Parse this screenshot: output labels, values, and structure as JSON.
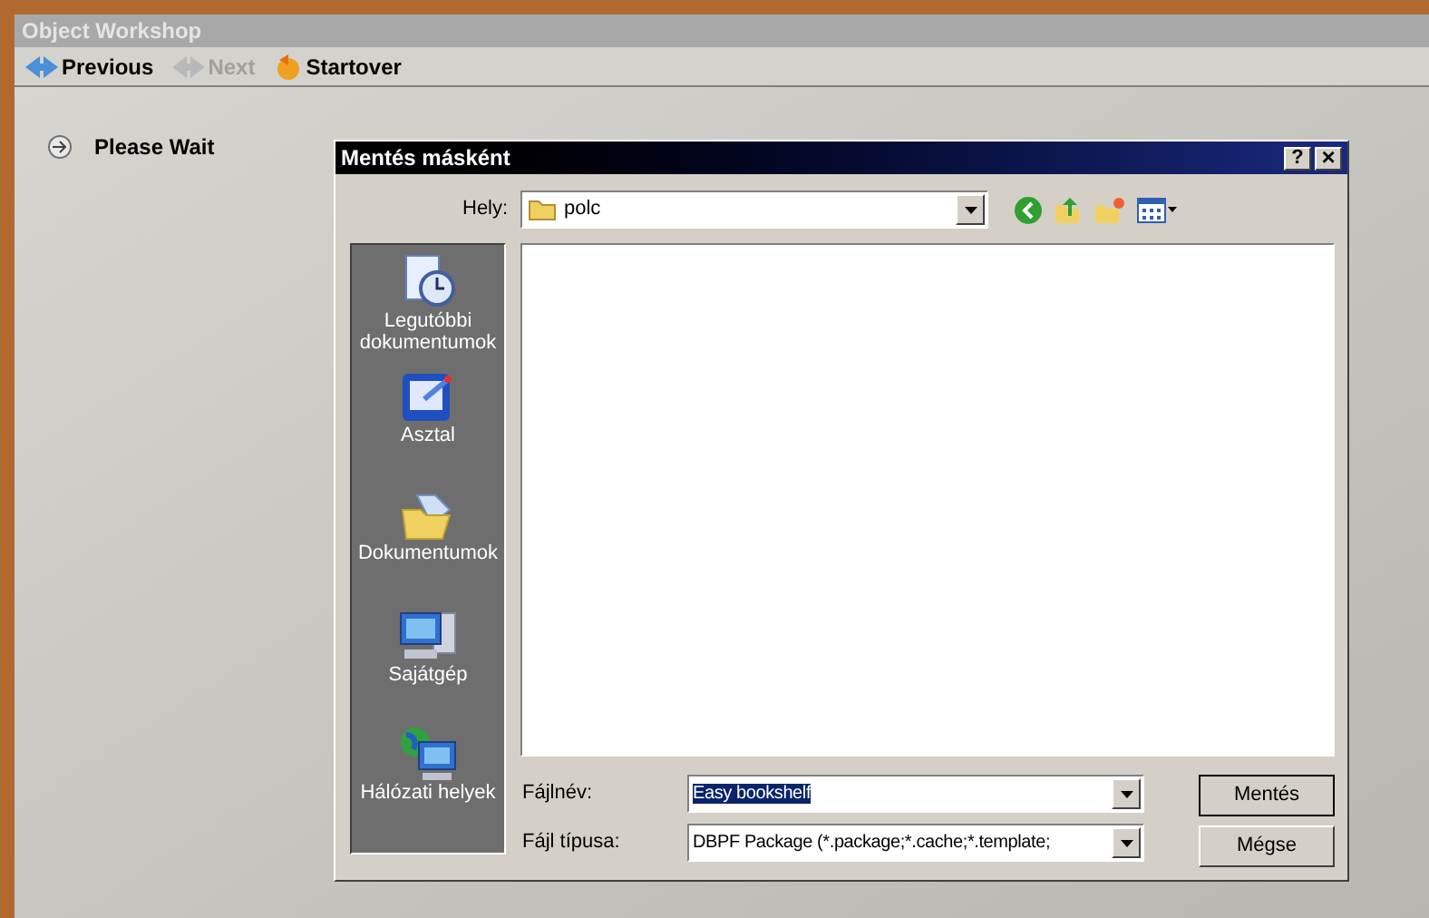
{
  "window": {
    "title": "Object Workshop"
  },
  "toolbar": [
    {
      "label": "Previous",
      "disabled": false,
      "kind": "back"
    },
    {
      "label": "Next",
      "disabled": true,
      "kind": "next"
    },
    {
      "label": "Startover",
      "disabled": false,
      "kind": "restart"
    }
  ],
  "steps": [
    {
      "label": "Please Wait"
    }
  ],
  "dialog": {
    "title": "Mentés másként",
    "help": "?",
    "close": "×",
    "location": {
      "label": "Hely:",
      "value": "polc"
    },
    "places": [
      {
        "label": "Legutóbbi dokumentumok",
        "kind": "recent"
      },
      {
        "label": "Asztal",
        "kind": "desktop"
      },
      {
        "label": "Dokumentumok",
        "kind": "documents"
      },
      {
        "label": "Sajátgép",
        "kind": "computer"
      },
      {
        "label": "Hálózati helyek",
        "kind": "network"
      }
    ],
    "filename": {
      "label": "Fájlnév:",
      "value": "Easy bookshelf"
    },
    "filetype": {
      "label": "Fájl típusa:",
      "value": "DBPF Package (*.package;*.cache;*.template;"
    },
    "buttons": [
      "Mentés",
      "Mégse"
    ]
  }
}
